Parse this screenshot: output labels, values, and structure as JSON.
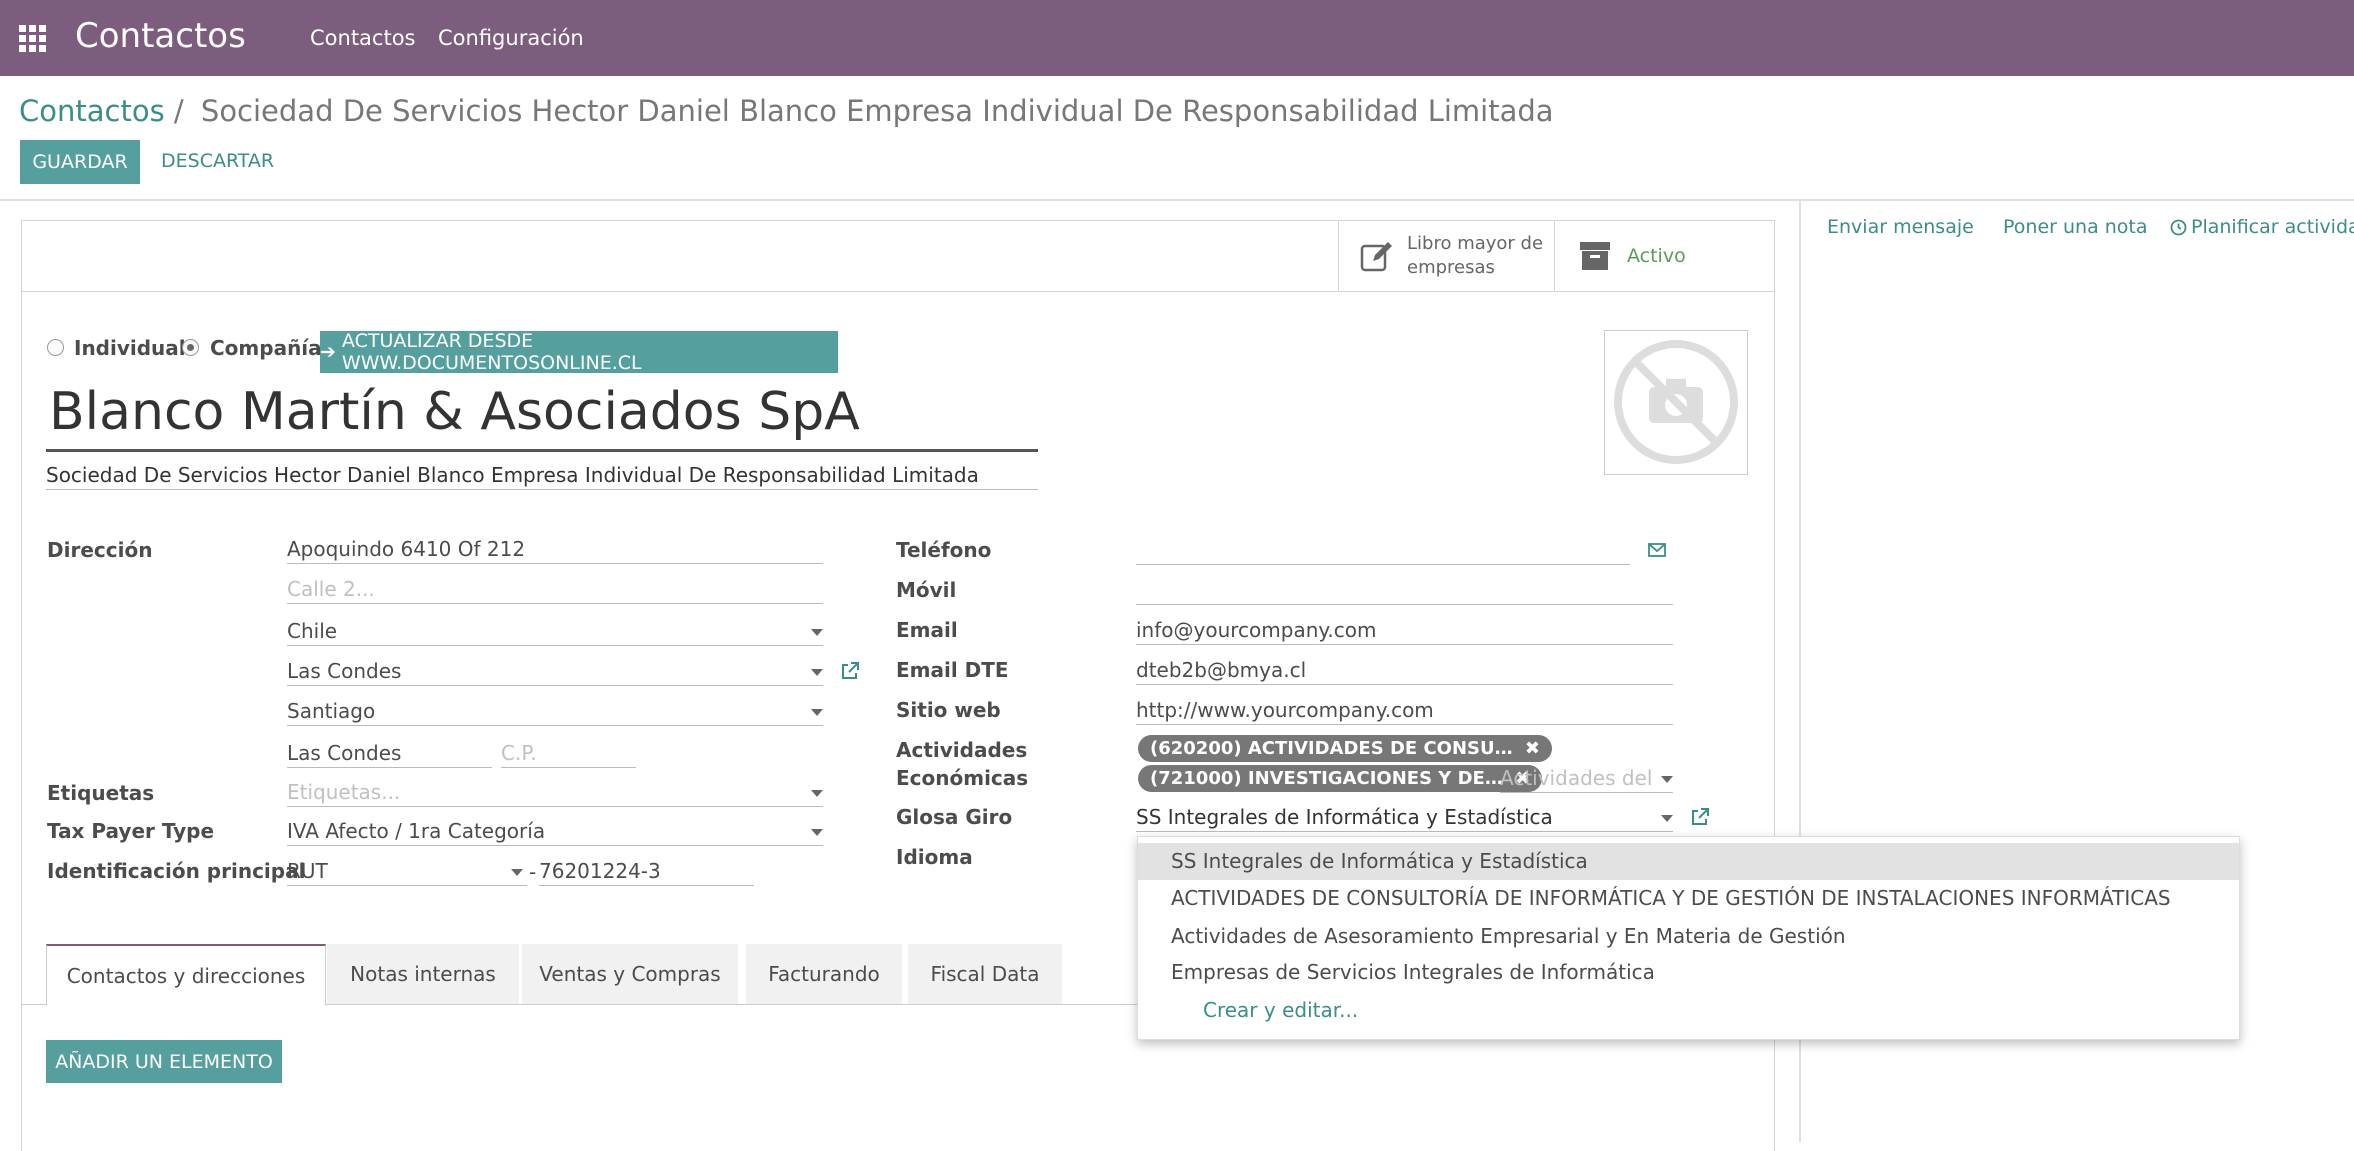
{
  "topbar": {
    "app_title": "Contactos",
    "menu": [
      "Contactos",
      "Configuración"
    ]
  },
  "breadcrumb": {
    "parent": "Contactos",
    "separator": "/",
    "current": "Sociedad De Servicios Hector Daniel Blanco Empresa Individual De Responsabilidad Limitada"
  },
  "actions": {
    "save": "GUARDAR",
    "discard": "DESCARTAR"
  },
  "stat_buttons": {
    "ledger": [
      "Libro mayor de",
      "empresas"
    ],
    "active": "Activo"
  },
  "chatter": {
    "send_message": "Enviar mensaje",
    "log_note": "Poner una nota",
    "schedule_activity": "Planificar actividad"
  },
  "company_type": {
    "individual": "Individual",
    "company": "Compañía",
    "selected": "Compañía"
  },
  "update_button": "ACTUALIZAR DESDE WWW.DOCUMENTOSONLINE.CL",
  "partner": {
    "name": "Blanco Martín & Asociados SpA",
    "legal_name": "Sociedad De Servicios Hector Daniel Blanco Empresa Individual De Responsabilidad Limitada"
  },
  "left_fields": {
    "address_label": "Dirección",
    "street": "Apoquindo 6410 Of 212",
    "street2_placeholder": "Calle 2...",
    "country": "Chile",
    "commune": "Las Condes",
    "city_select": "Santiago",
    "city": "Las Condes",
    "zip_placeholder": "C.P.",
    "tags_label": "Etiquetas",
    "tags_placeholder": "Etiquetas...",
    "tax_payer_label": "Tax Payer Type",
    "tax_payer_value": "IVA Afecto / 1ra Categoría",
    "id_label": "Identificación principal",
    "id_type": "RUT",
    "id_dash": "-",
    "id_value": "76201224-3"
  },
  "right_fields": {
    "phone_label": "Teléfono",
    "phone_value": "",
    "mobile_label": "Móvil",
    "mobile_value": "",
    "email_label": "Email",
    "email_value": "info@yourcompany.com",
    "email_dte_label": "Email DTE",
    "email_dte_value": "dteb2b@bmya.cl",
    "website_label": "Sitio web",
    "website_value": "http://www.yourcompany.com",
    "activities_label_1": "Actividades",
    "activities_label_2": "Económicas",
    "activities_tags": [
      "(620200) ACTIVIDADES DE CONSU…",
      "(721000) INVESTIGACIONES Y DE…"
    ],
    "activities_placeholder": "Actividades del",
    "giro_label": "Glosa Giro",
    "giro_value": "SS Integrales de Informática y Estadística",
    "language_label": "Idioma"
  },
  "dropdown": {
    "options": [
      "SS Integrales de Informática y Estadística",
      "ACTIVIDADES DE CONSULTORÍA DE INFORMÁTICA Y DE GESTIÓN DE INSTALACIONES INFORMÁTICAS",
      "Actividades de Asesoramiento Empresarial y En Materia de Gestión",
      "Empresas de Servicios Integrales de Informática"
    ],
    "create_edit": "Crear y editar..."
  },
  "tabs": [
    "Contactos y direcciones",
    "Notas internas",
    "Ventas y Compras",
    "Facturando",
    "Fiscal Data"
  ],
  "add_item": "AÑADIR UN ELEMENTO",
  "colors": {
    "topbar": "#7c5d7d",
    "accent": "#55a09f",
    "link": "#3b8d8a"
  }
}
